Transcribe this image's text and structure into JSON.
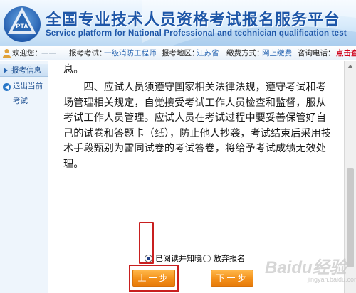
{
  "header": {
    "title_cn": "全国专业技术人员资格考试报名服务平台",
    "title_en": "Service platform for National Professional and technician qualification test",
    "logo_text": "PTA"
  },
  "infobar": {
    "welcome": "欢迎您：",
    "username": "——",
    "exam_label": "报考考试：",
    "exam_value": "一级消防工程师",
    "region_label": "报考地区：",
    "region_value": "江苏省",
    "pay_label": "缴费方式：",
    "pay_value": "网上缴费",
    "phone_label": "咨询电话：",
    "phone_link": "点击查"
  },
  "sidebar": {
    "header": "报考信息",
    "back": "退出当前",
    "exam": "考试"
  },
  "content": {
    "prev_tail": "息。",
    "clause4": "四、应试人员须遵守国家相关法律法规，遵守考试和考场管理相关规定，自觉接受考试工作人员检查和监督，服从考试工作人员管理。应试人员在考试过程中要妥善保管好自己的试卷和答题卡（纸），防止他人抄袭，考试结束后采用技术手段甄别为雷同试卷的考试答卷，将给予考试成绩无效处理。"
  },
  "form": {
    "agree_label": "已阅读并知晓",
    "giveup_label": "放弃报名",
    "agree_checked": true
  },
  "buttons": {
    "prev": "上一步",
    "next": "下一步"
  },
  "watermark": {
    "text": "Baidu经验",
    "sub": "jingyan.baidu.com"
  },
  "colors": {
    "brand_blue": "#1d56a8",
    "button_orange": "#f3901a",
    "highlight_red": "#c81f1f"
  }
}
